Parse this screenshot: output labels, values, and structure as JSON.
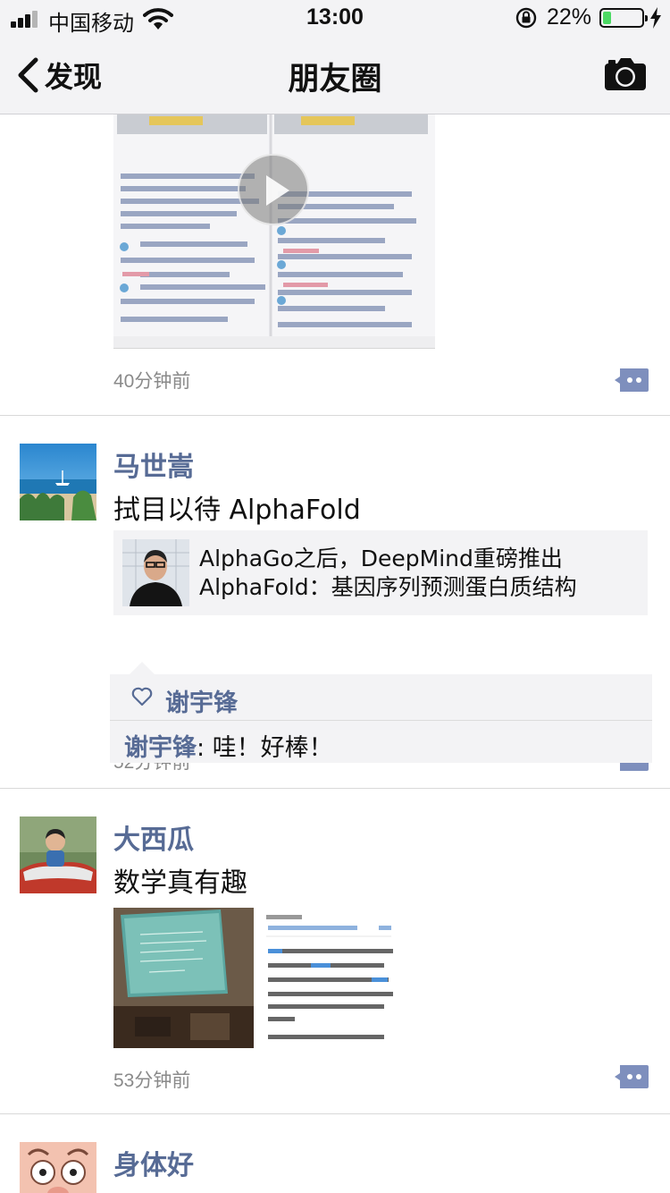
{
  "status_bar": {
    "carrier": "中国移动",
    "time": "13:00",
    "battery_percent": "22%",
    "battery_level": 0.22,
    "icons": [
      "signal-icon",
      "wifi-icon",
      "rotation-lock-icon",
      "battery-icon",
      "charging-icon"
    ]
  },
  "nav": {
    "back_label": "发现",
    "title": "朋友圈",
    "icons": [
      "chevron-left-icon",
      "camera-icon"
    ]
  },
  "posts": [
    {
      "time": "40分钟前",
      "media": "video",
      "icons": [
        "play-icon",
        "comment-more-icon"
      ]
    },
    {
      "name": "马世嵩",
      "text": "拭目以待 AlphaFold",
      "link_title": "AlphaGo之后，DeepMind重磅推出AlphaFold：基因序列预测蛋白质结构",
      "time": "52分钟前",
      "likes": "谢宇锋",
      "comment": {
        "user": "谢宇锋",
        "separator": ": ",
        "text": "哇！好棒！"
      },
      "icons": [
        "heart-icon",
        "comment-more-icon"
      ]
    },
    {
      "name": "大西瓜",
      "text": "数学真有趣",
      "time": "53分钟前",
      "photos": 2,
      "icons": [
        "comment-more-icon"
      ]
    },
    {
      "name": "身体好"
    }
  ],
  "colors": {
    "link_name": "#576b95",
    "bar_bg": "#f3f3f5",
    "time_gray": "#8a8a8a",
    "battery_green": "#4cd964"
  }
}
